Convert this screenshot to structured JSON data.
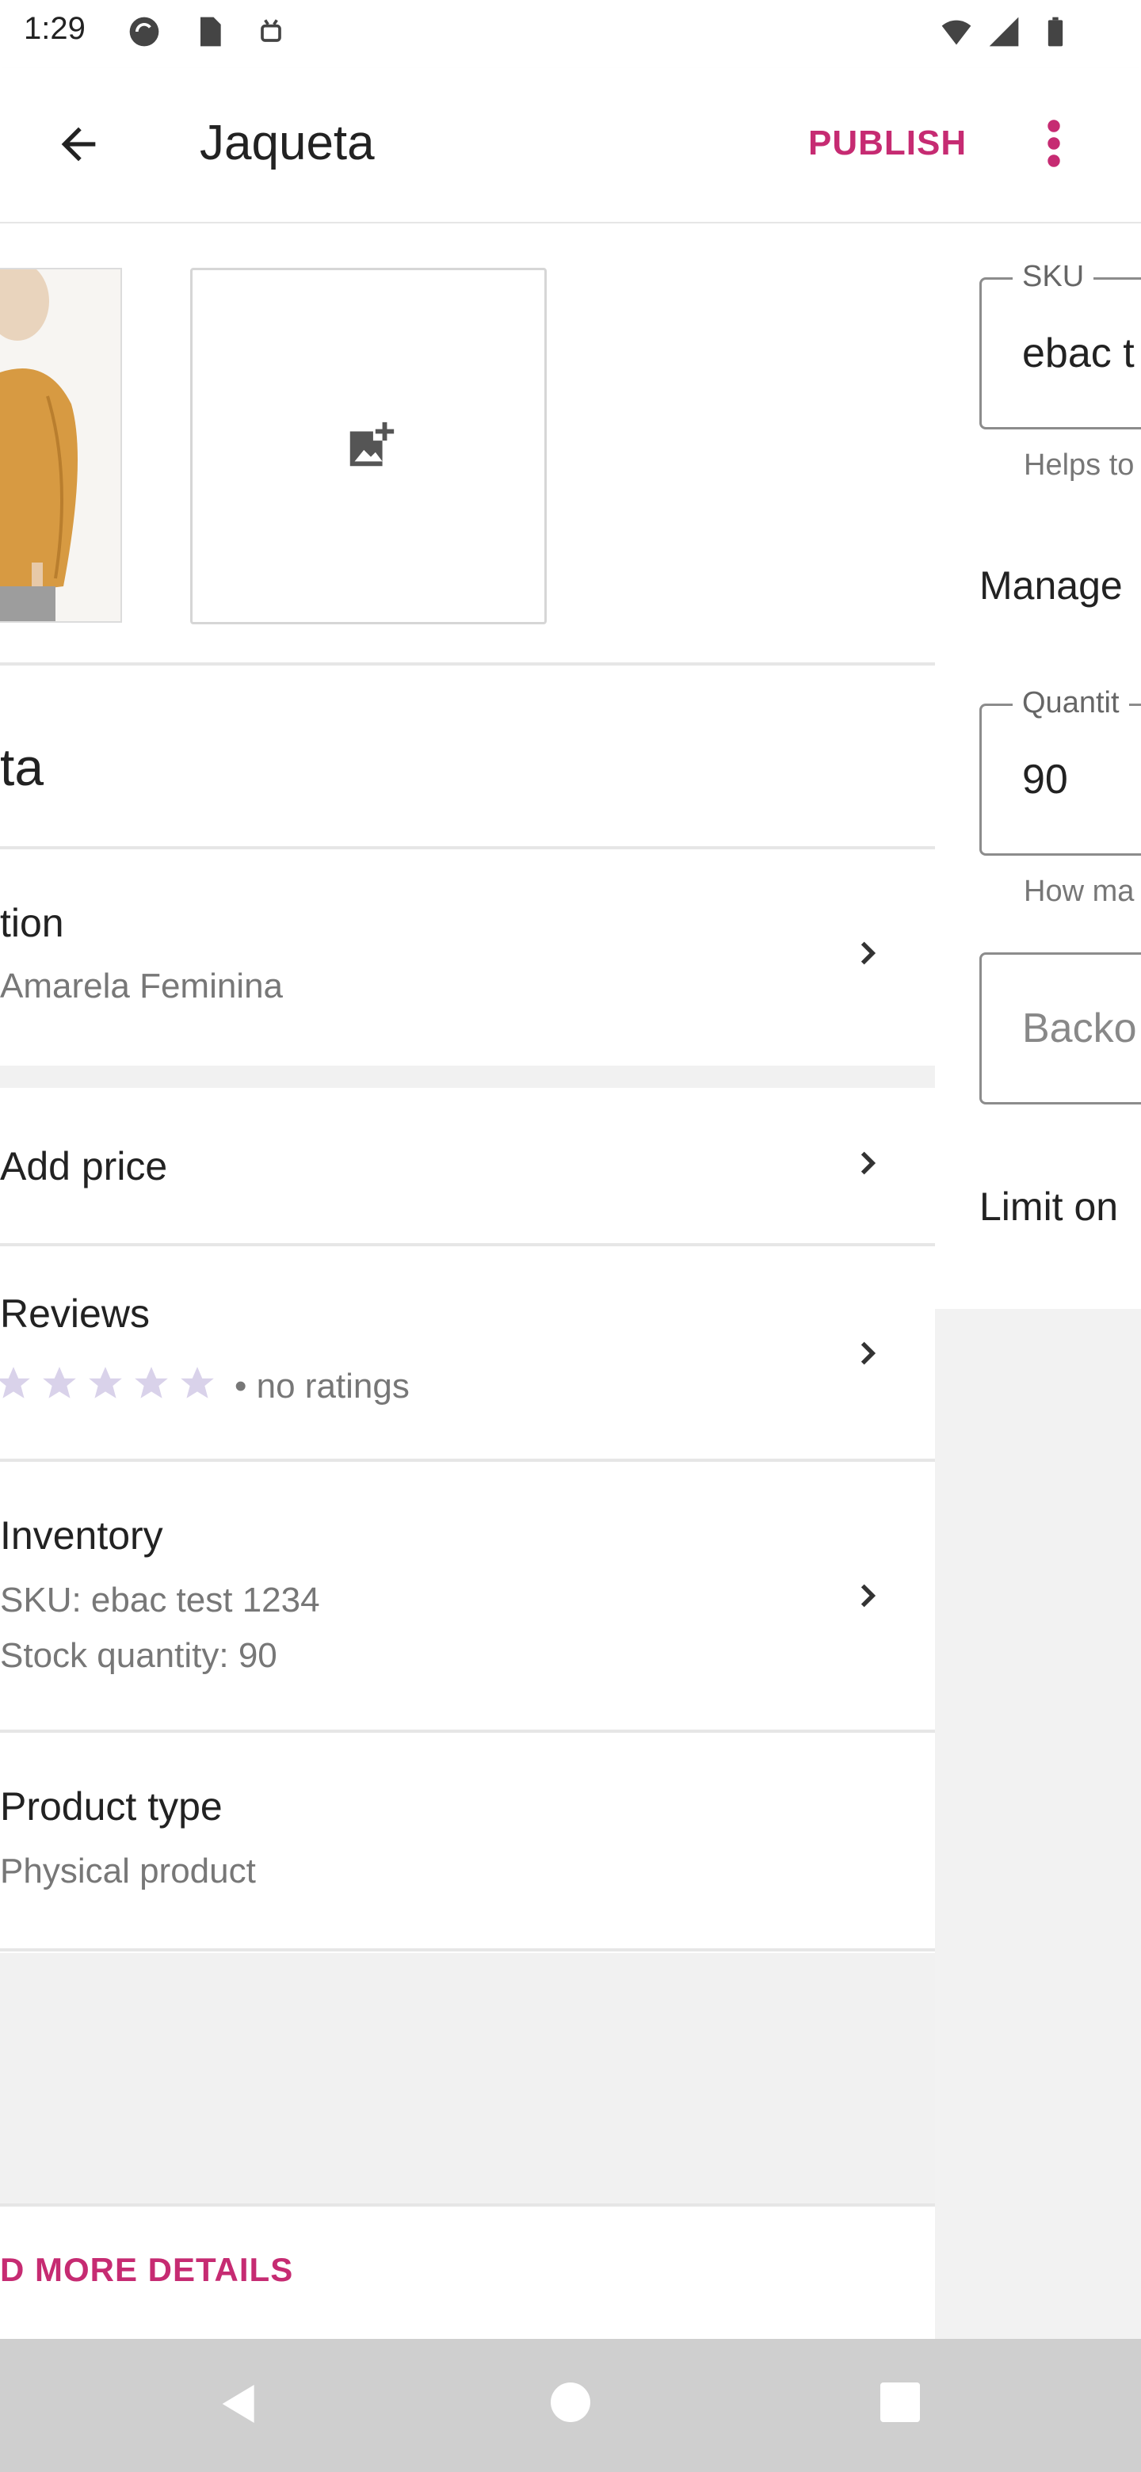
{
  "status_bar": {
    "time": "1:29"
  },
  "app_bar": {
    "title": "Jaqueta",
    "publish_label": "PUBLISH"
  },
  "product": {
    "name_partial": "ta",
    "description": {
      "title": "tion",
      "subtitle": "Amarela Feminina"
    },
    "price": {
      "label": "Add price"
    },
    "reviews": {
      "title": "Reviews",
      "rating_text": "• no ratings",
      "stars": 0
    },
    "inventory": {
      "title": "Inventory",
      "sku_line": "SKU: ebac test 1234",
      "stock_line": "Stock quantity: 90"
    },
    "product_type": {
      "title": "Product type",
      "subtitle": "Physical product"
    },
    "more_details": "D MORE DETAILS"
  },
  "inventory_panel": {
    "sku": {
      "label": "SKU",
      "value": "ebac t",
      "helper": "Helps to"
    },
    "manage_stock": "Manage",
    "quantity": {
      "label": "Quantit",
      "value": "90",
      "helper": "How ma"
    },
    "backorders": "Backo",
    "limit": "Limit on"
  },
  "colors": {
    "accent": "#c62b72",
    "star": "#d9d2ea"
  }
}
